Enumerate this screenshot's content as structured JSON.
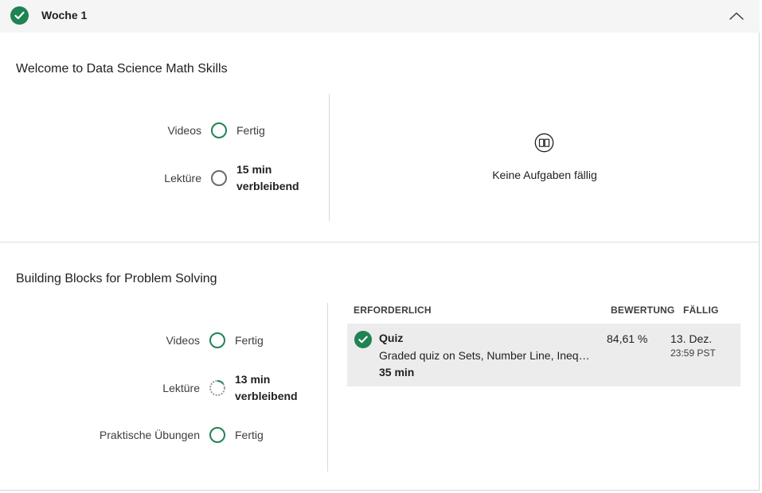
{
  "week": {
    "title": "Woche 1"
  },
  "modules": [
    {
      "title": "Welcome to Data Science Math Skills",
      "rows": [
        {
          "label": "Videos",
          "status": "Fertig"
        },
        {
          "label": "Lektüre",
          "status_line1": "15 min",
          "status_line2": "verbleibend"
        }
      ],
      "empty_text": "Keine Aufgaben fällig"
    },
    {
      "title": "Building Blocks for Problem Solving",
      "rows": [
        {
          "label": "Videos",
          "status": "Fertig"
        },
        {
          "label": "Lektüre",
          "status_line1": "13 min",
          "status_line2": "verbleibend",
          "progress": 0.15
        },
        {
          "label": "Praktische Übungen",
          "status": "Fertig"
        }
      ],
      "table": {
        "headers": {
          "required": "ERFORDERLICH",
          "grade": "BEWERTUNG",
          "due": "FÄLLIG"
        },
        "items": [
          {
            "title": "Quiz",
            "description": "Graded quiz on Sets, Number Line, Inequalities, Simplification, and Sigma Notation",
            "duration": "35 min",
            "grade": "84,61 %",
            "due_date": "13. Dez.",
            "due_time": "23:59 PST"
          }
        ]
      }
    }
  ],
  "colors": {
    "accent": "#1f8354",
    "header_bg": "#f5f5f5",
    "row_bg": "#ececec"
  }
}
